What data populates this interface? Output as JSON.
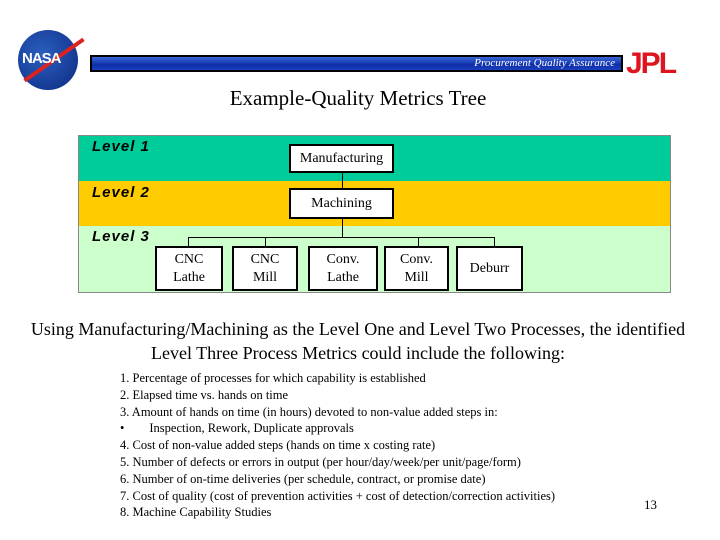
{
  "header": {
    "banner_text": "Procurement Quality Assurance",
    "logo_left": "NASA",
    "logo_right": "JPL"
  },
  "title": "Example-Quality Metrics Tree",
  "tree": {
    "colors": {
      "level1": "#00CC99",
      "level2": "#FFCC00",
      "level3": "#CCFFCC"
    },
    "levels": [
      {
        "label": "Level 1",
        "nodes": [
          "Manufacturing"
        ]
      },
      {
        "label": "Level 2",
        "nodes": [
          "Machining"
        ]
      },
      {
        "label": "Level 3",
        "nodes": [
          [
            "CNC",
            "Lathe"
          ],
          [
            "CNC",
            "Mill"
          ],
          [
            "Conv.",
            "Lathe"
          ],
          [
            "Conv.",
            "Mill"
          ],
          [
            "Deburr"
          ]
        ]
      }
    ]
  },
  "paragraph": "Using Manufacturing/Machining as the Level One and Level Two Processes, the identified Level Three Process Metrics could include the following:",
  "list": [
    "1. Percentage of processes for which capability is established",
    "2. Elapsed time vs. hands on time",
    "3. Amount of hands on time (in hours) devoted to non-value added steps in:",
    "•        Inspection, Rework, Duplicate approvals",
    "4. Cost of non-value added steps (hands on time x costing rate)",
    "5. Number of defects or errors in output (per hour/day/week/per unit/page/form)",
    "6. Number of on-time deliveries (per schedule, contract, or promise date)",
    "7. Cost of quality (cost of prevention activities + cost of detection/correction activities)",
    "8. Machine Capability Studies"
  ],
  "page_number": "13"
}
